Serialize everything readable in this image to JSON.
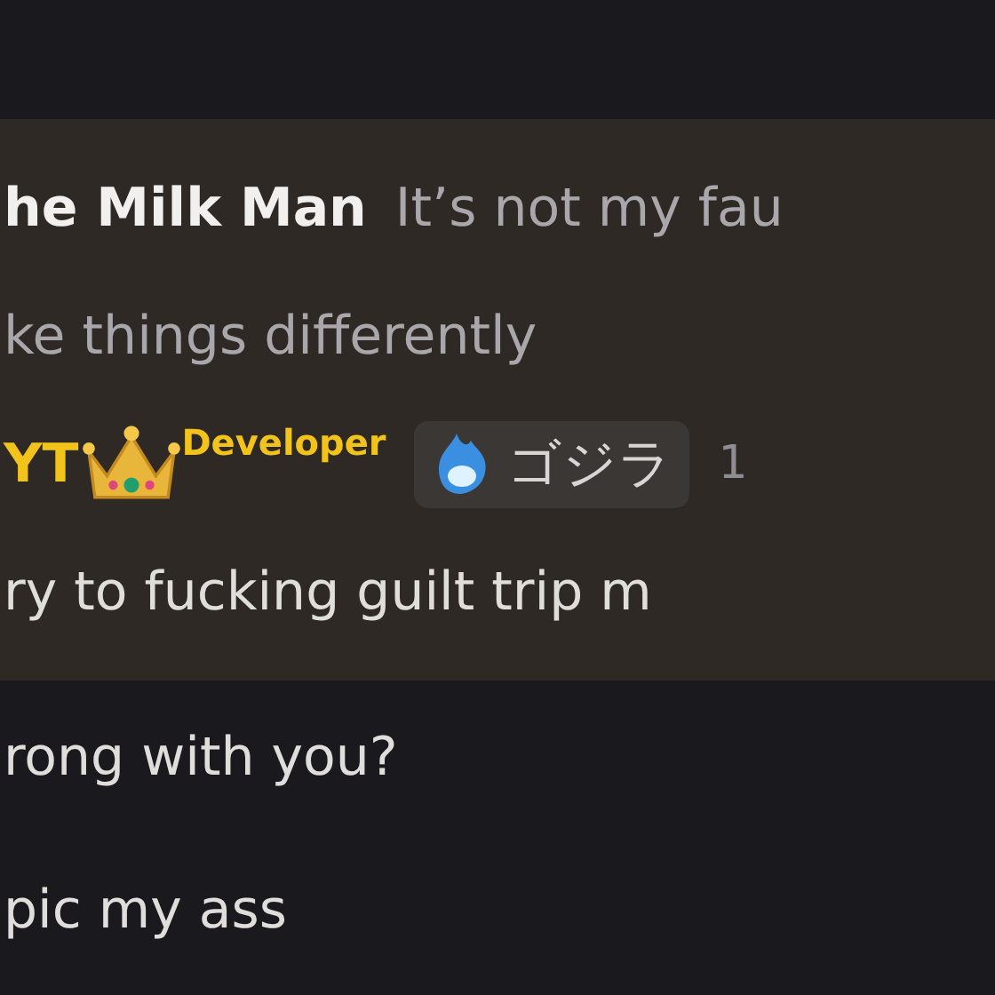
{
  "lines": [
    {
      "kind": "compact",
      "highlighted": true,
      "author": "he Milk Man",
      "text": "It’s not my fau"
    },
    {
      "kind": "text",
      "highlighted": true,
      "text": "ke things differently"
    },
    {
      "kind": "header",
      "highlighted": true,
      "author": "YT",
      "role": "Developer",
      "tag": "ゴジラ",
      "time": "1"
    },
    {
      "kind": "text",
      "highlighted": true,
      "text": "ry to fucking guilt trip m"
    },
    {
      "kind": "text",
      "highlighted": false,
      "text": "rong with you?"
    },
    {
      "kind": "text",
      "highlighted": false,
      "text": "pic my ass"
    }
  ]
}
